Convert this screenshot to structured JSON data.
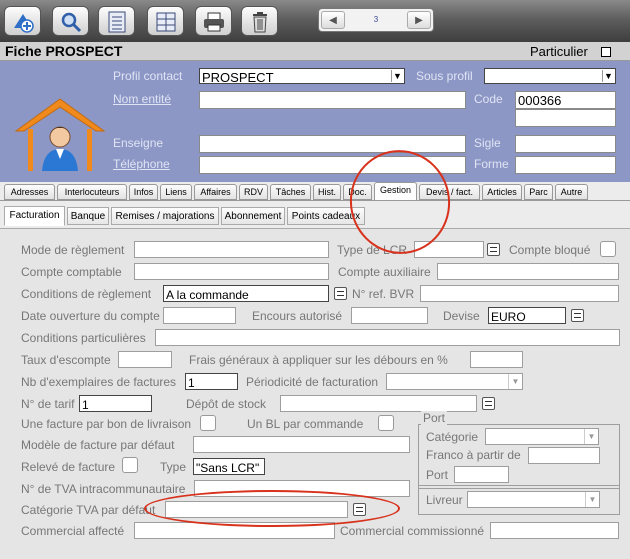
{
  "toolbar": {
    "buttons": [
      {
        "name": "add-button",
        "icon": "add-icon"
      },
      {
        "name": "search-button",
        "icon": "search-icon"
      },
      {
        "name": "list-button",
        "icon": "list-icon"
      },
      {
        "name": "grid-button",
        "icon": "grid-icon"
      },
      {
        "name": "print-button",
        "icon": "print-icon"
      },
      {
        "name": "delete-button",
        "icon": "trash-icon"
      }
    ],
    "pager": {
      "prev": "◀",
      "page": "3",
      "next": "▶"
    }
  },
  "record": {
    "title": "Fiche PROSPECT",
    "particulier_label": "Particulier"
  },
  "header": {
    "profil_contact_label": "Profil contact",
    "profil_contact_value": "PROSPECT",
    "sous_profil_label": "Sous profil",
    "nom_entite_label": "Nom entité",
    "code_label": "Code",
    "code_value": "000366",
    "enseigne_label": "Enseigne",
    "sigle_label": "Sigle",
    "telephone_label": "Téléphone",
    "forme_label": "Forme"
  },
  "tabs": [
    "Adresses",
    "Interlocuteurs",
    "Infos",
    "Liens",
    "Affaires",
    "RDV",
    "Tâches",
    "Hist.",
    "Doc.",
    "Gestion",
    "Devis / fact.",
    "Articles",
    "Parc",
    "Autre"
  ],
  "active_tab": "Gestion",
  "subtabs": [
    "Facturation",
    "Banque",
    "Remises / majorations",
    "Abonnement",
    "Points cadeaux"
  ],
  "active_subtab": "Facturation",
  "form": {
    "mode_reglement_label": "Mode de règlement",
    "type_lcr_label": "Type de LCR",
    "compte_bloque_label": "Compte bloqué",
    "compte_comptable_label": "Compte comptable",
    "compte_auxiliaire_label": "Compte auxiliaire",
    "conditions_reglement_label": "Conditions de règlement",
    "conditions_reglement_value": "A la commande",
    "ref_bvr_label": "N° ref. BVR",
    "date_ouverture_label": "Date ouverture du compte",
    "encours_label": "Encours autorisé",
    "devise_label": "Devise",
    "devise_value": "EURO",
    "conditions_particulieres_label": "Conditions particulières",
    "taux_escompte_label": "Taux d'escompte",
    "frais_generaux_label": "Frais généraux à appliquer sur les débours en %",
    "nb_exemplaires_label": "Nb d'exemplaires de factures",
    "nb_exemplaires_value": "1",
    "periodicite_label": "Périodicité de facturation",
    "num_tarif_label": "N° de tarif",
    "num_tarif_value": "1",
    "depot_stock_label": "Dépôt de stock",
    "une_facture_label": "Une facture par bon de livraison",
    "un_bl_label": "Un BL par commande",
    "port_label": "Port",
    "categorie_label": "Catégorie",
    "modele_facture_label": "Modèle de facture par défaut",
    "franco_label": "Franco à partir de",
    "releve_facture_label": "Relevé de facture",
    "type_label": "Type",
    "type_value": "\"Sans LCR\"",
    "port2_label": "Port",
    "tva_intra_label": "N° de TVA intracommunautaire",
    "livreur_label": "Livreur",
    "categorie_tva_label": "Catégorie TVA par défaut",
    "commercial_affecte_label": "Commercial affecté",
    "commercial_commissionne_label": "Commercial commissionné"
  },
  "colors": {
    "header_bg": "#8c97c6",
    "annotation": "#d8321c"
  }
}
